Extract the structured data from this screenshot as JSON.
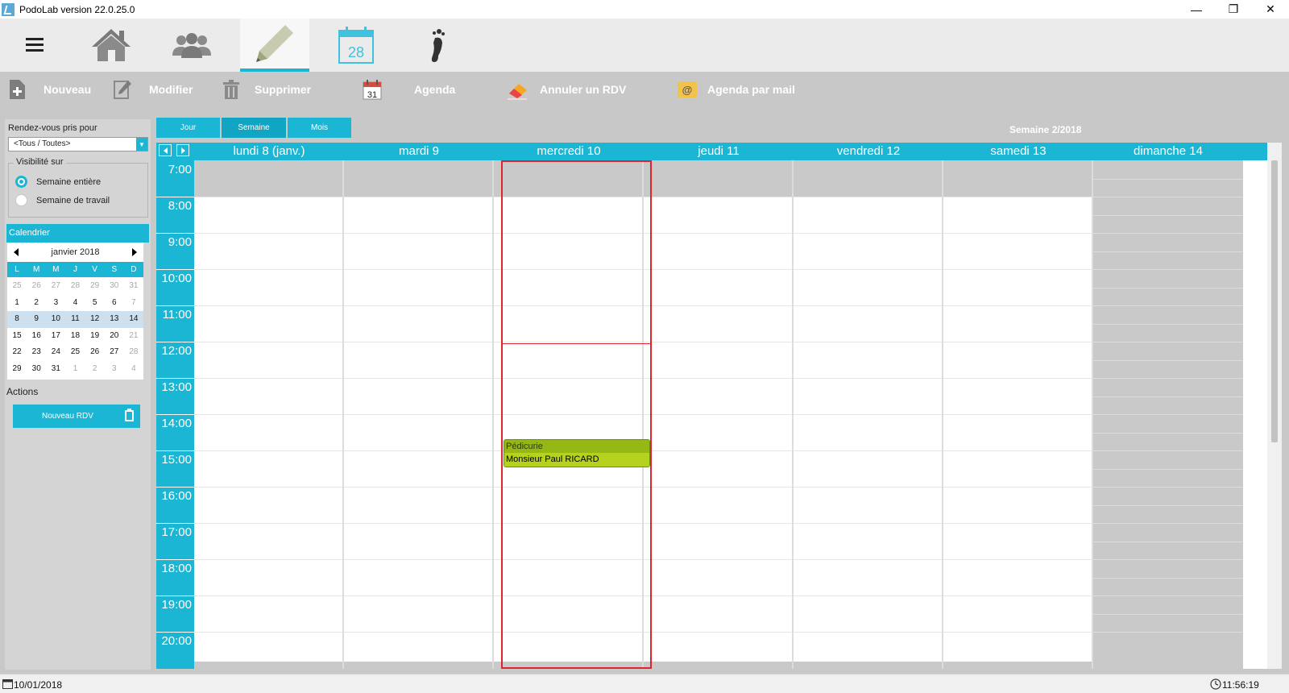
{
  "window": {
    "title": "PodoLab version 22.0.25.0",
    "minimize_glyph": "—",
    "restore_glyph": "❐",
    "close_glyph": "✕"
  },
  "nav": {
    "icons": [
      "menu-icon",
      "home-icon",
      "patients-icon",
      "edit-pen-icon",
      "calendar-28-icon",
      "footprint-icon"
    ],
    "calendar_day": "28"
  },
  "toolbar": {
    "nouveau": "Nouveau",
    "modifier": "Modifier",
    "supprimer": "Supprimer",
    "agenda": "Agenda",
    "agenda_day": "31",
    "annuler": "Annuler un RDV",
    "agenda_mail": "Agenda par mail"
  },
  "left_panel": {
    "rdv_for_label": "Rendez-vous pris pour",
    "rdv_for_value": "<Tous / Toutes>",
    "visibility_label": "Visibilité sur",
    "visibility_options": [
      "Semaine entière",
      "Semaine de travail"
    ],
    "visibility_selected": "Semaine entière",
    "calendar_title": "Calendrier",
    "month_label": "janvier 2018",
    "weekdays": [
      "L",
      "M",
      "M",
      "J",
      "V",
      "S",
      "D"
    ],
    "days": [
      [
        "25",
        "26",
        "27",
        "28",
        "29",
        "30",
        "31"
      ],
      [
        "1",
        "2",
        "3",
        "4",
        "5",
        "6",
        "7"
      ],
      [
        "8",
        "9",
        "10",
        "11",
        "12",
        "13",
        "14"
      ],
      [
        "15",
        "16",
        "17",
        "18",
        "19",
        "20",
        "21"
      ],
      [
        "22",
        "23",
        "24",
        "25",
        "26",
        "27",
        "28"
      ],
      [
        "29",
        "30",
        "31",
        "1",
        "2",
        "3",
        "4"
      ]
    ],
    "actions_label": "Actions",
    "new_rdv_button": "Nouveau RDV"
  },
  "view_tabs": [
    "Jour",
    "Semaine",
    "Mois"
  ],
  "active_view": "Semaine",
  "week_label": "Semaine 2/2018",
  "scheduler": {
    "days": [
      "lundi 8 (janv.)",
      "mardi 9",
      "mercredi 10",
      "jeudi 11",
      "vendredi 12",
      "samedi 13",
      "dimanche 14"
    ],
    "today": "mercredi 10",
    "hours": [
      "7:00",
      "8:00",
      "9:00",
      "10:00",
      "11:00",
      "12:00",
      "13:00",
      "14:00",
      "15:00",
      "16:00",
      "17:00",
      "18:00",
      "19:00",
      "20:00"
    ],
    "appointment": {
      "category": "Pédicurie",
      "patient": "Monsieur Paul RICARD",
      "color": "#9fc31a"
    }
  },
  "colors": {
    "accent": "#1ab6d3",
    "today_border": "#e0242e"
  },
  "status": {
    "date": "10/01/2018",
    "time": "11:56:19"
  }
}
